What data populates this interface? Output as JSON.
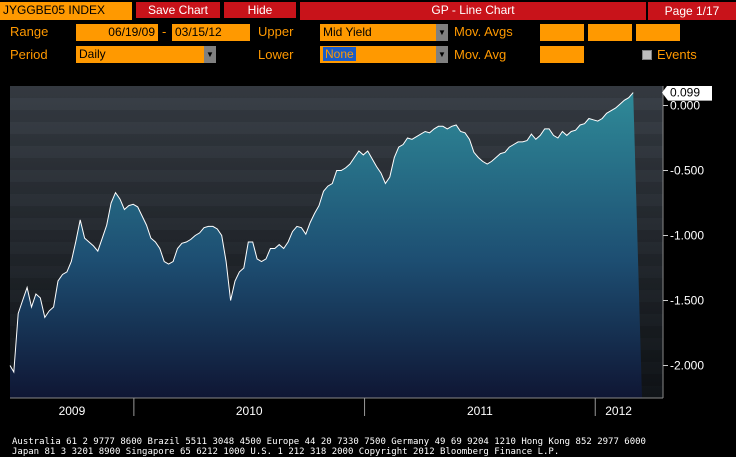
{
  "toolbar": {
    "ticker": "JYGGBE05 INDEX",
    "save_chart": "Save Chart",
    "hide": "Hide",
    "title": "GP - Line Chart",
    "page": "Page 1/17"
  },
  "controls": {
    "range_label": "Range",
    "range_start": "06/19/09",
    "range_sep": "-",
    "range_end": "03/15/12",
    "upper_label": "Upper",
    "upper_value": "Mid Yield",
    "mov_avgs_label": "Mov. Avgs",
    "period_label": "Period",
    "period_value": "Daily",
    "lower_label": "Lower",
    "lower_value": "None",
    "mov_avg_label": "Mov. Avg",
    "events_label": "Events",
    "events_checked": false
  },
  "chart_data": {
    "type": "area",
    "title": "",
    "xlabel": "",
    "ylabel": "",
    "ylim": [
      -2.25,
      0.15
    ],
    "y_ticks": [
      "0.000",
      "-0.500",
      "-1.000",
      "-1.500",
      "-2.000"
    ],
    "x_tick_labels": [
      "2009",
      "2010",
      "2011",
      "2012"
    ],
    "last_value_label": "0.099",
    "last_value": 0.099,
    "series": [
      {
        "dates": [
          "2009-06-19",
          "2009-06-25",
          "2009-07-02",
          "2009-07-09",
          "2009-07-16",
          "2009-07-23",
          "2009-07-30",
          "2009-08-06",
          "2009-08-13",
          "2009-08-20",
          "2009-08-27",
          "2009-09-03",
          "2009-09-10",
          "2009-09-17",
          "2009-09-24",
          "2009-10-01",
          "2009-10-08",
          "2009-10-15",
          "2009-10-22",
          "2009-10-29",
          "2009-11-05",
          "2009-11-12",
          "2009-11-19",
          "2009-11-26",
          "2009-12-03",
          "2009-12-10",
          "2009-12-17",
          "2009-12-24",
          "2009-12-31",
          "2010-01-07",
          "2010-01-14",
          "2010-01-21",
          "2010-01-28",
          "2010-02-04",
          "2010-02-11",
          "2010-02-18",
          "2010-02-25",
          "2010-03-04",
          "2010-03-11",
          "2010-03-18",
          "2010-03-25",
          "2010-04-01",
          "2010-04-08",
          "2010-04-15",
          "2010-04-22",
          "2010-04-29",
          "2010-05-06",
          "2010-05-13",
          "2010-05-20",
          "2010-05-27",
          "2010-06-03",
          "2010-06-10",
          "2010-06-17",
          "2010-06-24",
          "2010-07-01",
          "2010-07-08",
          "2010-07-15",
          "2010-07-22",
          "2010-07-29",
          "2010-08-05",
          "2010-08-12",
          "2010-08-19",
          "2010-08-26",
          "2010-09-02",
          "2010-09-09",
          "2010-09-16",
          "2010-09-23",
          "2010-09-30",
          "2010-10-07",
          "2010-10-14",
          "2010-10-21",
          "2010-10-28",
          "2010-11-04",
          "2010-11-11",
          "2010-11-18",
          "2010-11-25",
          "2010-12-02",
          "2010-12-09",
          "2010-12-16",
          "2010-12-23",
          "2010-12-30",
          "2011-01-06",
          "2011-01-13",
          "2011-01-20",
          "2011-01-27",
          "2011-02-03",
          "2011-02-10",
          "2011-02-17",
          "2011-02-24",
          "2011-03-03",
          "2011-03-10",
          "2011-03-17",
          "2011-03-24",
          "2011-03-31",
          "2011-04-07",
          "2011-04-14",
          "2011-04-21",
          "2011-04-28",
          "2011-05-05",
          "2011-05-12",
          "2011-05-19",
          "2011-05-26",
          "2011-06-02",
          "2011-06-09",
          "2011-06-16",
          "2011-06-23",
          "2011-06-30",
          "2011-07-07",
          "2011-07-14",
          "2011-07-21",
          "2011-07-28",
          "2011-08-04",
          "2011-08-11",
          "2011-08-18",
          "2011-08-25",
          "2011-09-01",
          "2011-09-08",
          "2011-09-15",
          "2011-09-22",
          "2011-09-29",
          "2011-10-06",
          "2011-10-13",
          "2011-10-20",
          "2011-10-27",
          "2011-11-03",
          "2011-11-10",
          "2011-11-17",
          "2011-11-24",
          "2011-12-01",
          "2011-12-08",
          "2011-12-15",
          "2011-12-22",
          "2011-12-29",
          "2012-01-05",
          "2012-01-12",
          "2012-01-19",
          "2012-01-26",
          "2012-02-02",
          "2012-02-09",
          "2012-02-16",
          "2012-02-23",
          "2012-03-01",
          "2012-03-08",
          "2012-03-15"
        ],
        "values": [
          -2.0,
          -2.05,
          -1.6,
          -1.5,
          -1.4,
          -1.55,
          -1.45,
          -1.48,
          -1.63,
          -1.58,
          -1.55,
          -1.35,
          -1.3,
          -1.28,
          -1.2,
          -1.05,
          -0.88,
          -1.02,
          -1.05,
          -1.08,
          -1.12,
          -1.02,
          -0.92,
          -0.75,
          -0.67,
          -0.72,
          -0.8,
          -0.77,
          -0.76,
          -0.78,
          -0.85,
          -0.92,
          -1.02,
          -1.05,
          -1.1,
          -1.2,
          -1.22,
          -1.2,
          -1.1,
          -1.06,
          -1.05,
          -1.03,
          -1.0,
          -0.98,
          -0.94,
          -0.93,
          -0.93,
          -0.95,
          -1.0,
          -1.2,
          -1.5,
          -1.35,
          -1.28,
          -1.25,
          -1.05,
          -1.05,
          -1.18,
          -1.2,
          -1.18,
          -1.1,
          -1.1,
          -1.07,
          -1.1,
          -1.05,
          -0.97,
          -0.93,
          -0.94,
          -0.99,
          -0.9,
          -0.83,
          -0.77,
          -0.66,
          -0.62,
          -0.6,
          -0.5,
          -0.5,
          -0.48,
          -0.45,
          -0.4,
          -0.35,
          -0.38,
          -0.35,
          -0.41,
          -0.47,
          -0.52,
          -0.6,
          -0.55,
          -0.4,
          -0.32,
          -0.3,
          -0.25,
          -0.26,
          -0.24,
          -0.22,
          -0.2,
          -0.21,
          -0.18,
          -0.16,
          -0.16,
          -0.18,
          -0.16,
          -0.15,
          -0.2,
          -0.21,
          -0.26,
          -0.36,
          -0.4,
          -0.43,
          -0.45,
          -0.43,
          -0.4,
          -0.37,
          -0.36,
          -0.32,
          -0.3,
          -0.28,
          -0.28,
          -0.27,
          -0.22,
          -0.26,
          -0.23,
          -0.18,
          -0.18,
          -0.23,
          -0.25,
          -0.2,
          -0.23,
          -0.2,
          -0.19,
          -0.15,
          -0.14,
          -0.1,
          -0.11,
          -0.12,
          -0.1,
          -0.06,
          -0.04,
          -0.02,
          0.01,
          0.04,
          0.06,
          0.099
        ]
      }
    ],
    "grid": false,
    "colors": {
      "line": "#ffffff",
      "fill_top": "#2f8a98",
      "fill_bottom": "#101838",
      "axis_text": "#ffffff",
      "year_text": "#ffffff"
    }
  },
  "footer": {
    "line1": "Australia 61 2 9777 8600 Brazil 5511 3048 4500 Europe 44 20 7330 7500 Germany 49 69 9204 1210 Hong Kong 852 2977 6000",
    "line2": "Japan 81 3 3201 8900          Singapore 65 6212 1000          U.S. 1 212 318 2000          Copyright 2012 Bloomberg Finance L.P."
  }
}
